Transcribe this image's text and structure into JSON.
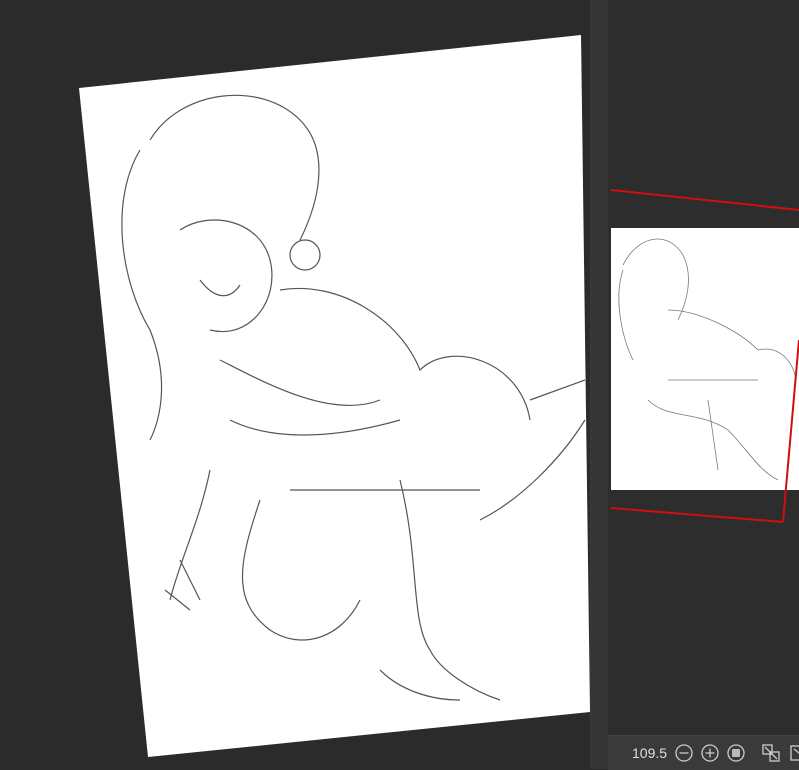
{
  "navigator": {
    "zoom_value": "109.5",
    "frame_color": "#d01010"
  },
  "icons": [
    "zoom-out-icon",
    "zoom-in-icon",
    "fit-icon",
    "flip-icon",
    "rotate-icon"
  ]
}
